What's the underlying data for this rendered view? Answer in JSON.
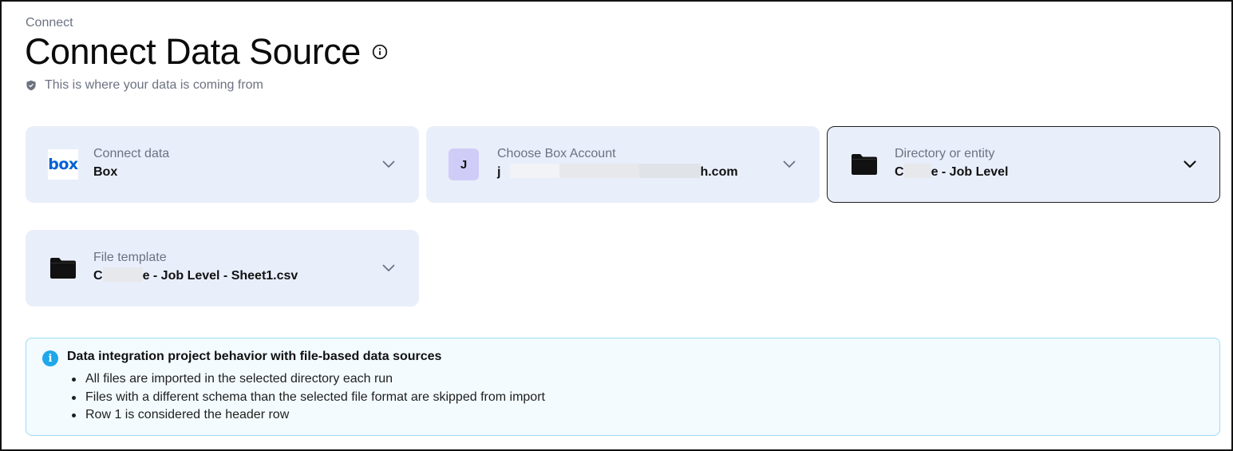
{
  "breadcrumb": "Connect",
  "title": "Connect Data Source",
  "subtitle": "This is where your data is coming from",
  "cards": {
    "connect_data": {
      "label": "Connect data",
      "value": "Box",
      "logo_text": "box"
    },
    "box_account": {
      "label": "Choose Box Account",
      "avatar": "J",
      "value_start": "j",
      "value_end": "h.com"
    },
    "directory": {
      "label": "Directory or entity",
      "value_start": "C",
      "value_end": "e - Job Level"
    },
    "file_template": {
      "label": "File template",
      "value_start": "C",
      "value_end": "e - Job Level - Sheet1.csv"
    }
  },
  "info": {
    "heading": "Data integration project behavior with file-based data sources",
    "items": [
      "All files are imported in the selected directory each run",
      "Files with a different schema than the selected file format are skipped from import",
      "Row 1 is considered the header row"
    ]
  },
  "colors": {
    "card_bg": "#e9eefb",
    "box_blue": "#0061d5",
    "info_blue": "#1fa7ea",
    "info_bg": "#f3fbfe",
    "avatar_bg": "#cfcdf7"
  }
}
